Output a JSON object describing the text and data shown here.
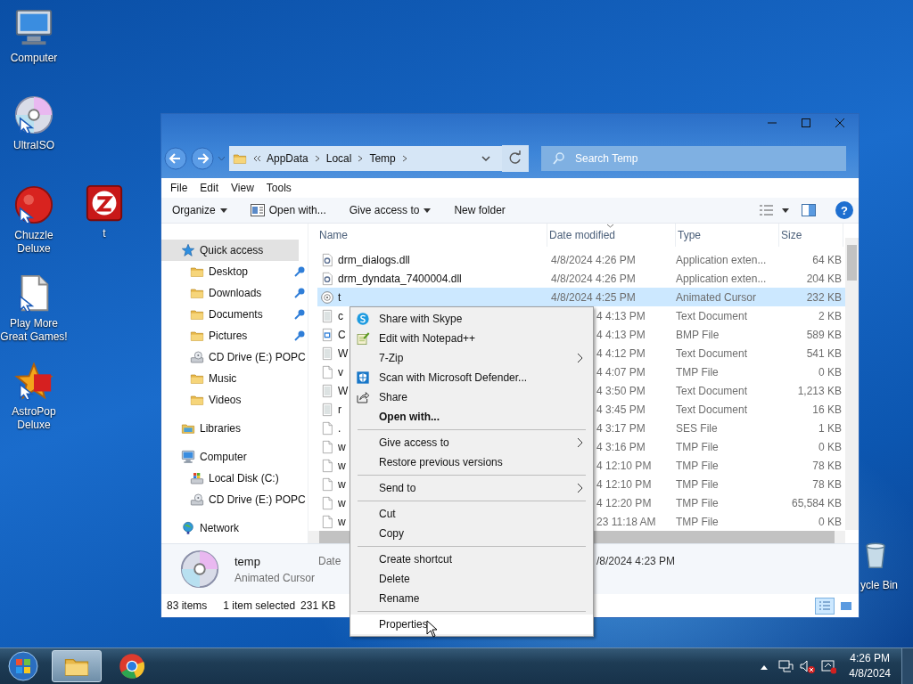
{
  "desktop_icons": [
    {
      "label": "Computer",
      "shortcut": false
    },
    {
      "label": "UltraISO",
      "shortcut": true
    },
    {
      "label": "Chuzzle Deluxe",
      "shortcut": true
    },
    {
      "label": "t",
      "shortcut": false
    },
    {
      "label": "Play More Great Games!",
      "shortcut": true
    },
    {
      "label": "AstroPop Deluxe",
      "shortcut": true
    },
    {
      "label": "ycle Bin",
      "shortcut": false
    }
  ],
  "window": {
    "address": {
      "crumbs": [
        "AppData",
        "Local",
        "Temp"
      ]
    },
    "search": {
      "placeholder": "Search Temp"
    },
    "menu_bar": [
      "File",
      "Edit",
      "View",
      "Tools"
    ],
    "toolbar": [
      {
        "label": "Organize",
        "dropdown": true
      },
      {
        "label": "Open with...",
        "dropdown": false
      },
      {
        "label": "Give access to",
        "dropdown": true
      },
      {
        "label": "New folder",
        "dropdown": false
      }
    ],
    "help": "?",
    "nav": [
      {
        "label": "Quick access",
        "kind": "star",
        "pinned": false,
        "selected": true,
        "children": [
          {
            "label": "Desktop",
            "kind": "folder",
            "pinned": true,
            "selected": false
          },
          {
            "label": "Downloads",
            "kind": "folder",
            "pinned": true,
            "selected": false
          },
          {
            "label": "Documents",
            "kind": "folder",
            "pinned": true,
            "selected": false
          },
          {
            "label": "Pictures",
            "kind": "folder",
            "pinned": true,
            "selected": false
          },
          {
            "label": "CD Drive (E:) POPC",
            "kind": "cd",
            "pinned": false,
            "selected": false
          },
          {
            "label": "Music",
            "kind": "folder",
            "pinned": false,
            "selected": false
          },
          {
            "label": "Videos",
            "kind": "folder",
            "pinned": false,
            "selected": false
          }
        ]
      },
      {
        "label": "Libraries",
        "kind": "library",
        "pinned": false,
        "selected": false
      },
      {
        "label": "Computer",
        "kind": "computer",
        "pinned": false,
        "selected": false,
        "children": [
          {
            "label": "Local Disk (C:)",
            "kind": "disk",
            "pinned": false,
            "selected": false
          },
          {
            "label": "CD Drive (E:) POPC",
            "kind": "cd",
            "pinned": false,
            "selected": false
          }
        ]
      },
      {
        "label": "Network",
        "kind": "network",
        "pinned": false,
        "selected": false
      }
    ],
    "columns": [
      {
        "label": "Name",
        "sorted": false
      },
      {
        "label": "Date modified",
        "sorted": true
      },
      {
        "label": "Type",
        "sorted": false
      },
      {
        "label": "Size",
        "sorted": false
      }
    ],
    "rows": [
      {
        "name": "drm_dialogs.dll",
        "date": "4/8/2024 4:26 PM",
        "type": "Application exten...",
        "size": "64 KB",
        "kind": "dll",
        "selected": false
      },
      {
        "name": "drm_dyndata_7400004.dll",
        "date": "4/8/2024 4:26 PM",
        "type": "Application exten...",
        "size": "204 KB",
        "kind": "dll",
        "selected": false
      },
      {
        "name": "t",
        "date": "4/8/2024 4:25 PM",
        "type": "Animated Cursor",
        "size": "232 KB",
        "kind": "cursor",
        "selected": true
      },
      {
        "name": "c",
        "date": "4 4:13 PM",
        "type": "Text Document",
        "size": "2 KB",
        "kind": "text",
        "selected": false
      },
      {
        "name": "C",
        "date": "4 4:13 PM",
        "type": "BMP File",
        "size": "589 KB",
        "kind": "bmp",
        "selected": false
      },
      {
        "name": "W",
        "date": "4 4:12 PM",
        "type": "Text Document",
        "size": "541 KB",
        "kind": "text",
        "selected": false
      },
      {
        "name": "v",
        "date": "4 4:07 PM",
        "type": "TMP File",
        "size": "0 KB",
        "kind": "blank",
        "selected": false
      },
      {
        "name": "W",
        "date": "4 3:50 PM",
        "type": "Text Document",
        "size": "1,213 KB",
        "kind": "text",
        "selected": false
      },
      {
        "name": "r",
        "date": "4 3:45 PM",
        "type": "Text Document",
        "size": "16 KB",
        "kind": "text",
        "selected": false
      },
      {
        "name": ".",
        "date": "4 3:17 PM",
        "type": "SES File",
        "size": "1 KB",
        "kind": "blank",
        "selected": false
      },
      {
        "name": "w",
        "date": "4 3:16 PM",
        "type": "TMP File",
        "size": "0 KB",
        "kind": "blank",
        "selected": false
      },
      {
        "name": "w",
        "date": "4 12:10 PM",
        "type": "TMP File",
        "size": "78 KB",
        "kind": "blank",
        "selected": false
      },
      {
        "name": "w",
        "date": "4 12:10 PM",
        "type": "TMP File",
        "size": "78 KB",
        "kind": "blank",
        "selected": false
      },
      {
        "name": "w",
        "date": "4 12:20 PM",
        "type": "TMP File",
        "size": "65,584 KB",
        "kind": "blank",
        "selected": false
      },
      {
        "name": "w",
        "date": "23 11:18 AM",
        "type": "TMP File",
        "size": "0 KB",
        "kind": "blank",
        "selected": false
      }
    ],
    "details": {
      "name": "temp",
      "type": "Animated Cursor",
      "date_label": "Date",
      "date": "/8/2024 4:23 PM"
    },
    "status": {
      "count": "83 items",
      "selection": "1 item selected",
      "size": "231 KB"
    },
    "views": [
      {
        "kind": "details",
        "selected": true
      },
      {
        "kind": "tiles",
        "selected": false
      }
    ]
  },
  "context_menu": {
    "items": [
      {
        "kind": "item",
        "label": "Share with Skype",
        "submenu": false,
        "bold": false,
        "selected": false
      },
      {
        "kind": "item",
        "label": "Edit with Notepad++",
        "submenu": false,
        "bold": false,
        "selected": false
      },
      {
        "kind": "item",
        "label": "7-Zip",
        "submenu": true,
        "bold": false,
        "selected": false
      },
      {
        "kind": "item",
        "label": "Scan with Microsoft Defender...",
        "submenu": false,
        "bold": false,
        "selected": false
      },
      {
        "kind": "item",
        "label": "Share",
        "submenu": false,
        "bold": false,
        "selected": false
      },
      {
        "kind": "item",
        "label": "Open with...",
        "submenu": false,
        "bold": true,
        "selected": false
      },
      {
        "kind": "separator"
      },
      {
        "kind": "item",
        "label": "Give access to",
        "submenu": true,
        "bold": false,
        "selected": false
      },
      {
        "kind": "item",
        "label": "Restore previous versions",
        "submenu": false,
        "bold": false,
        "selected": false
      },
      {
        "kind": "separator"
      },
      {
        "kind": "item",
        "label": "Send to",
        "submenu": true,
        "bold": false,
        "selected": false
      },
      {
        "kind": "separator"
      },
      {
        "kind": "item",
        "label": "Cut",
        "submenu": false,
        "bold": false,
        "selected": false
      },
      {
        "kind": "item",
        "label": "Copy",
        "submenu": false,
        "bold": false,
        "selected": false
      },
      {
        "kind": "separator"
      },
      {
        "kind": "item",
        "label": "Create shortcut",
        "submenu": false,
        "bold": false,
        "selected": false
      },
      {
        "kind": "item",
        "label": "Delete",
        "submenu": false,
        "bold": false,
        "selected": false
      },
      {
        "kind": "item",
        "label": "Rename",
        "submenu": false,
        "bold": false,
        "selected": false
      },
      {
        "kind": "separator"
      },
      {
        "kind": "item",
        "label": "Properties",
        "submenu": false,
        "bold": false,
        "selected": true
      }
    ]
  },
  "taskbar": {
    "apps": [
      {
        "active": true
      },
      {
        "active": false
      }
    ],
    "time": "4:26 PM",
    "date": "4/8/2024"
  }
}
